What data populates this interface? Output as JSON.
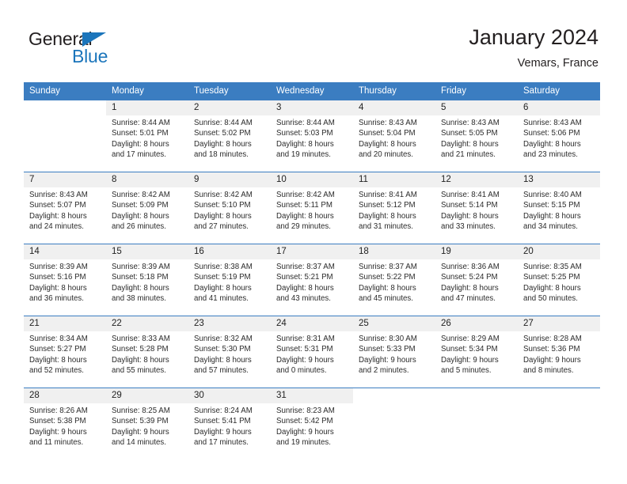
{
  "brand": {
    "name_dark": "General",
    "name_blue": "Blue",
    "accent_color": "#1b75bb"
  },
  "header": {
    "title": "January 2024",
    "subtitle": "Vemars, France"
  },
  "theme": {
    "header_row_bg": "#3b7dc1",
    "daynum_bg": "#f0f0f0",
    "row_border": "#3b7dc1",
    "text": "#231f20"
  },
  "weekday_headers": [
    "Sunday",
    "Monday",
    "Tuesday",
    "Wednesday",
    "Thursday",
    "Friday",
    "Saturday"
  ],
  "weeks": [
    {
      "days": [
        {
          "day": "",
          "sunrise": "",
          "sunset": "",
          "daylight_line1": "",
          "daylight_line2": ""
        },
        {
          "day": "1",
          "sunrise": "Sunrise: 8:44 AM",
          "sunset": "Sunset: 5:01 PM",
          "daylight_line1": "Daylight: 8 hours",
          "daylight_line2": "and 17 minutes."
        },
        {
          "day": "2",
          "sunrise": "Sunrise: 8:44 AM",
          "sunset": "Sunset: 5:02 PM",
          "daylight_line1": "Daylight: 8 hours",
          "daylight_line2": "and 18 minutes."
        },
        {
          "day": "3",
          "sunrise": "Sunrise: 8:44 AM",
          "sunset": "Sunset: 5:03 PM",
          "daylight_line1": "Daylight: 8 hours",
          "daylight_line2": "and 19 minutes."
        },
        {
          "day": "4",
          "sunrise": "Sunrise: 8:43 AM",
          "sunset": "Sunset: 5:04 PM",
          "daylight_line1": "Daylight: 8 hours",
          "daylight_line2": "and 20 minutes."
        },
        {
          "day": "5",
          "sunrise": "Sunrise: 8:43 AM",
          "sunset": "Sunset: 5:05 PM",
          "daylight_line1": "Daylight: 8 hours",
          "daylight_line2": "and 21 minutes."
        },
        {
          "day": "6",
          "sunrise": "Sunrise: 8:43 AM",
          "sunset": "Sunset: 5:06 PM",
          "daylight_line1": "Daylight: 8 hours",
          "daylight_line2": "and 23 minutes."
        }
      ]
    },
    {
      "days": [
        {
          "day": "7",
          "sunrise": "Sunrise: 8:43 AM",
          "sunset": "Sunset: 5:07 PM",
          "daylight_line1": "Daylight: 8 hours",
          "daylight_line2": "and 24 minutes."
        },
        {
          "day": "8",
          "sunrise": "Sunrise: 8:42 AM",
          "sunset": "Sunset: 5:09 PM",
          "daylight_line1": "Daylight: 8 hours",
          "daylight_line2": "and 26 minutes."
        },
        {
          "day": "9",
          "sunrise": "Sunrise: 8:42 AM",
          "sunset": "Sunset: 5:10 PM",
          "daylight_line1": "Daylight: 8 hours",
          "daylight_line2": "and 27 minutes."
        },
        {
          "day": "10",
          "sunrise": "Sunrise: 8:42 AM",
          "sunset": "Sunset: 5:11 PM",
          "daylight_line1": "Daylight: 8 hours",
          "daylight_line2": "and 29 minutes."
        },
        {
          "day": "11",
          "sunrise": "Sunrise: 8:41 AM",
          "sunset": "Sunset: 5:12 PM",
          "daylight_line1": "Daylight: 8 hours",
          "daylight_line2": "and 31 minutes."
        },
        {
          "day": "12",
          "sunrise": "Sunrise: 8:41 AM",
          "sunset": "Sunset: 5:14 PM",
          "daylight_line1": "Daylight: 8 hours",
          "daylight_line2": "and 33 minutes."
        },
        {
          "day": "13",
          "sunrise": "Sunrise: 8:40 AM",
          "sunset": "Sunset: 5:15 PM",
          "daylight_line1": "Daylight: 8 hours",
          "daylight_line2": "and 34 minutes."
        }
      ]
    },
    {
      "days": [
        {
          "day": "14",
          "sunrise": "Sunrise: 8:39 AM",
          "sunset": "Sunset: 5:16 PM",
          "daylight_line1": "Daylight: 8 hours",
          "daylight_line2": "and 36 minutes."
        },
        {
          "day": "15",
          "sunrise": "Sunrise: 8:39 AM",
          "sunset": "Sunset: 5:18 PM",
          "daylight_line1": "Daylight: 8 hours",
          "daylight_line2": "and 38 minutes."
        },
        {
          "day": "16",
          "sunrise": "Sunrise: 8:38 AM",
          "sunset": "Sunset: 5:19 PM",
          "daylight_line1": "Daylight: 8 hours",
          "daylight_line2": "and 41 minutes."
        },
        {
          "day": "17",
          "sunrise": "Sunrise: 8:37 AM",
          "sunset": "Sunset: 5:21 PM",
          "daylight_line1": "Daylight: 8 hours",
          "daylight_line2": "and 43 minutes."
        },
        {
          "day": "18",
          "sunrise": "Sunrise: 8:37 AM",
          "sunset": "Sunset: 5:22 PM",
          "daylight_line1": "Daylight: 8 hours",
          "daylight_line2": "and 45 minutes."
        },
        {
          "day": "19",
          "sunrise": "Sunrise: 8:36 AM",
          "sunset": "Sunset: 5:24 PM",
          "daylight_line1": "Daylight: 8 hours",
          "daylight_line2": "and 47 minutes."
        },
        {
          "day": "20",
          "sunrise": "Sunrise: 8:35 AM",
          "sunset": "Sunset: 5:25 PM",
          "daylight_line1": "Daylight: 8 hours",
          "daylight_line2": "and 50 minutes."
        }
      ]
    },
    {
      "days": [
        {
          "day": "21",
          "sunrise": "Sunrise: 8:34 AM",
          "sunset": "Sunset: 5:27 PM",
          "daylight_line1": "Daylight: 8 hours",
          "daylight_line2": "and 52 minutes."
        },
        {
          "day": "22",
          "sunrise": "Sunrise: 8:33 AM",
          "sunset": "Sunset: 5:28 PM",
          "daylight_line1": "Daylight: 8 hours",
          "daylight_line2": "and 55 minutes."
        },
        {
          "day": "23",
          "sunrise": "Sunrise: 8:32 AM",
          "sunset": "Sunset: 5:30 PM",
          "daylight_line1": "Daylight: 8 hours",
          "daylight_line2": "and 57 minutes."
        },
        {
          "day": "24",
          "sunrise": "Sunrise: 8:31 AM",
          "sunset": "Sunset: 5:31 PM",
          "daylight_line1": "Daylight: 9 hours",
          "daylight_line2": "and 0 minutes."
        },
        {
          "day": "25",
          "sunrise": "Sunrise: 8:30 AM",
          "sunset": "Sunset: 5:33 PM",
          "daylight_line1": "Daylight: 9 hours",
          "daylight_line2": "and 2 minutes."
        },
        {
          "day": "26",
          "sunrise": "Sunrise: 8:29 AM",
          "sunset": "Sunset: 5:34 PM",
          "daylight_line1": "Daylight: 9 hours",
          "daylight_line2": "and 5 minutes."
        },
        {
          "day": "27",
          "sunrise": "Sunrise: 8:28 AM",
          "sunset": "Sunset: 5:36 PM",
          "daylight_line1": "Daylight: 9 hours",
          "daylight_line2": "and 8 minutes."
        }
      ]
    },
    {
      "days": [
        {
          "day": "28",
          "sunrise": "Sunrise: 8:26 AM",
          "sunset": "Sunset: 5:38 PM",
          "daylight_line1": "Daylight: 9 hours",
          "daylight_line2": "and 11 minutes."
        },
        {
          "day": "29",
          "sunrise": "Sunrise: 8:25 AM",
          "sunset": "Sunset: 5:39 PM",
          "daylight_line1": "Daylight: 9 hours",
          "daylight_line2": "and 14 minutes."
        },
        {
          "day": "30",
          "sunrise": "Sunrise: 8:24 AM",
          "sunset": "Sunset: 5:41 PM",
          "daylight_line1": "Daylight: 9 hours",
          "daylight_line2": "and 17 minutes."
        },
        {
          "day": "31",
          "sunrise": "Sunrise: 8:23 AM",
          "sunset": "Sunset: 5:42 PM",
          "daylight_line1": "Daylight: 9 hours",
          "daylight_line2": "and 19 minutes."
        },
        {
          "day": "",
          "sunrise": "",
          "sunset": "",
          "daylight_line1": "",
          "daylight_line2": ""
        },
        {
          "day": "",
          "sunrise": "",
          "sunset": "",
          "daylight_line1": "",
          "daylight_line2": ""
        },
        {
          "day": "",
          "sunrise": "",
          "sunset": "",
          "daylight_line1": "",
          "daylight_line2": ""
        }
      ]
    }
  ]
}
